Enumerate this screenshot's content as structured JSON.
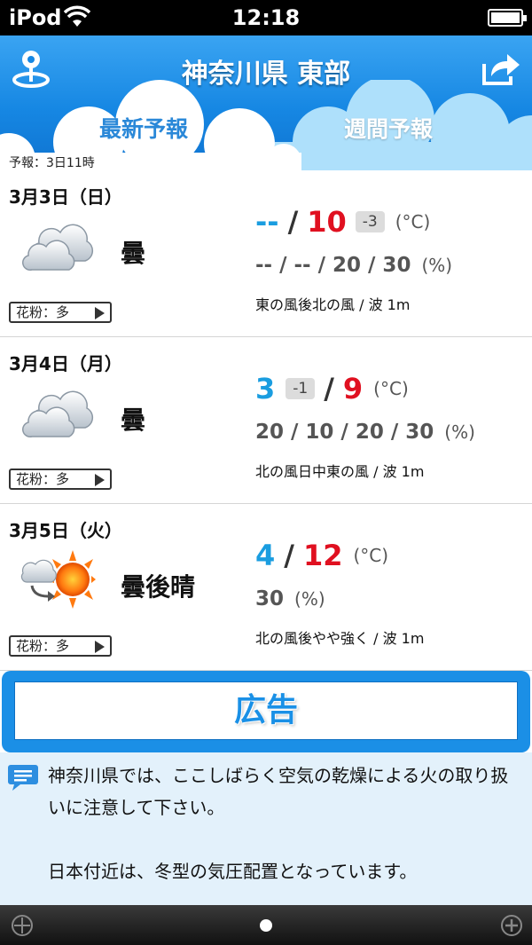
{
  "status_bar": {
    "carrier": "iPod",
    "time": "12:18"
  },
  "header": {
    "title": "神奈川県 東部",
    "tabs": [
      {
        "label": "最新予報",
        "active": true
      },
      {
        "label": "週間予報",
        "active": false
      }
    ],
    "issued": "予報：3日11時"
  },
  "days": [
    {
      "date": "3月3日（日）",
      "icon": "cloudy-icon",
      "condition": "曇",
      "temp_low": "--",
      "temp_high": "10",
      "temp_diff": "-3",
      "temp_unit": "(°C)",
      "pop": "-- / -- / 20 / 30",
      "pop_unit": "(%)",
      "wind": "東の風後北の風 / 波 1m",
      "pollen": "花粉：多"
    },
    {
      "date": "3月4日（月）",
      "icon": "cloudy-icon",
      "condition": "曇",
      "temp_low": "3",
      "temp_low_diff": "-1",
      "temp_high": "9",
      "temp_unit": "(°C)",
      "pop": "20 / 10 / 20 / 30",
      "pop_unit": "(%)",
      "wind": "北の風日中東の風 / 波 1m",
      "pollen": "花粉：多"
    },
    {
      "date": "3月5日（火）",
      "icon": "cloudy-then-sunny-icon",
      "condition": "曇後晴",
      "temp_low": "4",
      "temp_high": "12",
      "temp_unit": "(°C)",
      "pop": "30",
      "pop_unit": "(%)",
      "wind": "北の風後やや強く / 波 1m",
      "pollen": "花粉：多"
    }
  ],
  "ad": {
    "label": "広告"
  },
  "comment": {
    "text": "神奈川県では、ここしばらく空気の乾燥による火の取り扱いに注意して下さい。\n\n日本付近は、冬型の気圧配置となっています。"
  },
  "colors": {
    "low_temp": "#1a9de0",
    "high_temp": "#e01020",
    "header_blue": "#1687e3"
  }
}
